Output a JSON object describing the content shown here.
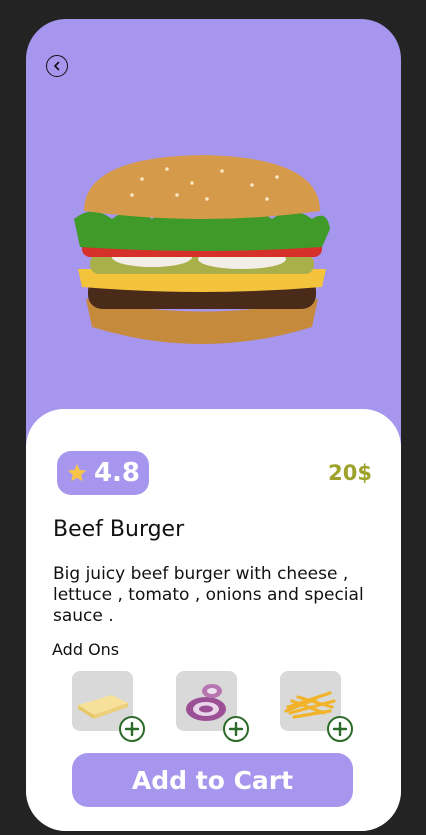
{
  "product": {
    "name": "Beef Burger",
    "rating": "4.8",
    "price": "20$",
    "description": "Big juicy beef burger with cheese , lettuce , tomato , onions and special sauce ."
  },
  "addons": {
    "label": "Add Ons",
    "items": [
      {
        "name": "cheese",
        "icon": "cheese-icon"
      },
      {
        "name": "onion",
        "icon": "onion-icon"
      },
      {
        "name": "fries",
        "icon": "fries-icon"
      }
    ]
  },
  "cart": {
    "label": "Add to Cart"
  },
  "colors": {
    "accent": "#a796ee",
    "price": "#9ea22a",
    "plus": "#2c6b2a"
  }
}
